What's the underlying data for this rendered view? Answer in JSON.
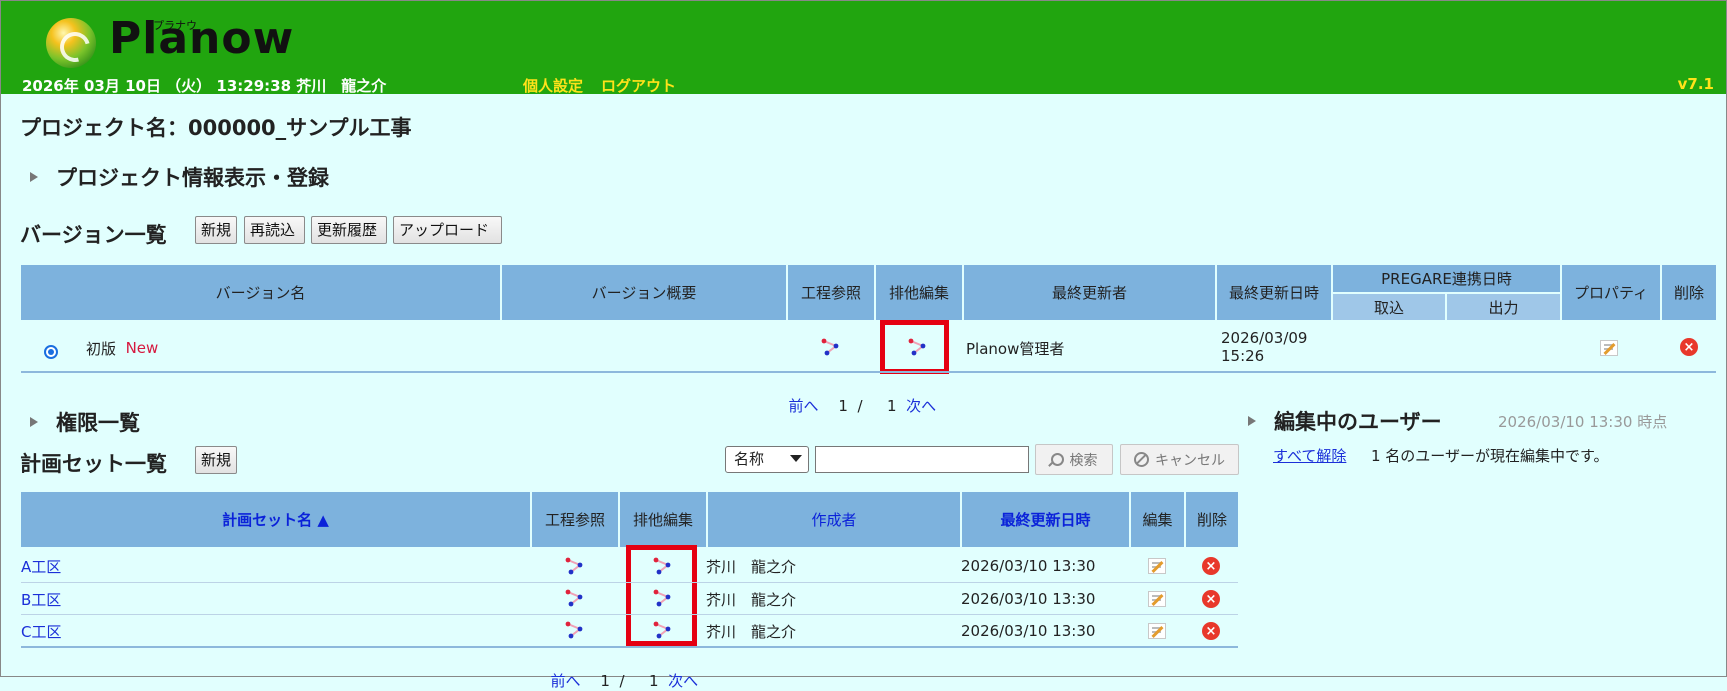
{
  "header": {
    "logo_text": "Planow",
    "logo_ruby": "プラナウ",
    "datetime_user": "2026年 03月 10日 （火） 13:29:38 芥川　龍之介",
    "personal_settings": "個人設定",
    "logout": "ログアウト",
    "version": "v7.1",
    "colors": {
      "bar": "#21a50f",
      "links": "#ffe21a"
    }
  },
  "project_title": "プロジェクト名：000000_サンプル工事",
  "project_info_section": "プロジェクト情報表示・登録",
  "versions": {
    "heading": "バージョン一覧",
    "buttons": {
      "new": "新規",
      "reload": "再読込",
      "history": "更新履歴",
      "upload": "アップロード"
    },
    "columns": {
      "name": "バージョン名",
      "summary": "バージョン概要",
      "process_ref": "工程参照",
      "exclusive_edit": "排他編集",
      "last_updater": "最終更新者",
      "last_updated": "最終更新日時",
      "pregare": "PREGARE連携日時",
      "import": "取込",
      "export": "出力",
      "property": "プロパティ",
      "delete": "削除"
    },
    "rows": [
      {
        "name": "初版",
        "badge": "New",
        "updater": "Planow管理者",
        "updated_date": "2026/03/09",
        "updated_time": "15:26"
      }
    ],
    "pager": {
      "prev": "前へ",
      "current": "1",
      "sep": "/",
      "total": "1",
      "next": "次へ"
    }
  },
  "permissions_section": "権限一覧",
  "plansets": {
    "heading": "計画セット一覧",
    "new_button": "新規",
    "search": {
      "field": "名称",
      "value": "",
      "search_button": "検索",
      "cancel_button": "キャンセル"
    },
    "columns": {
      "name": "計画セット名 ▲",
      "process_ref": "工程参照",
      "exclusive_edit": "排他編集",
      "creator": "作成者",
      "last_updated": "最終更新日時",
      "edit": "編集",
      "delete": "削除"
    },
    "rows": [
      {
        "name": "A工区",
        "creator": "芥川　龍之介",
        "updated": "2026/03/10 13:30"
      },
      {
        "name": "B工区",
        "creator": "芥川　龍之介",
        "updated": "2026/03/10 13:30"
      },
      {
        "name": "C工区",
        "creator": "芥川　龍之介",
        "updated": "2026/03/10 13:30"
      }
    ],
    "pager": {
      "prev": "前へ",
      "current": "1",
      "sep": "/",
      "total": "1",
      "next": "次へ"
    }
  },
  "editing_users": {
    "heading": "編集中のユーザー",
    "as_of": "2026/03/10 13:30 時点",
    "release_all": "すべて解除",
    "status": "1 名のユーザーが現在編集中です。"
  },
  "icons": [
    "gantt-icon",
    "edit-icon",
    "delete-icon",
    "radio-selected"
  ],
  "highlight_color": "#e50012"
}
